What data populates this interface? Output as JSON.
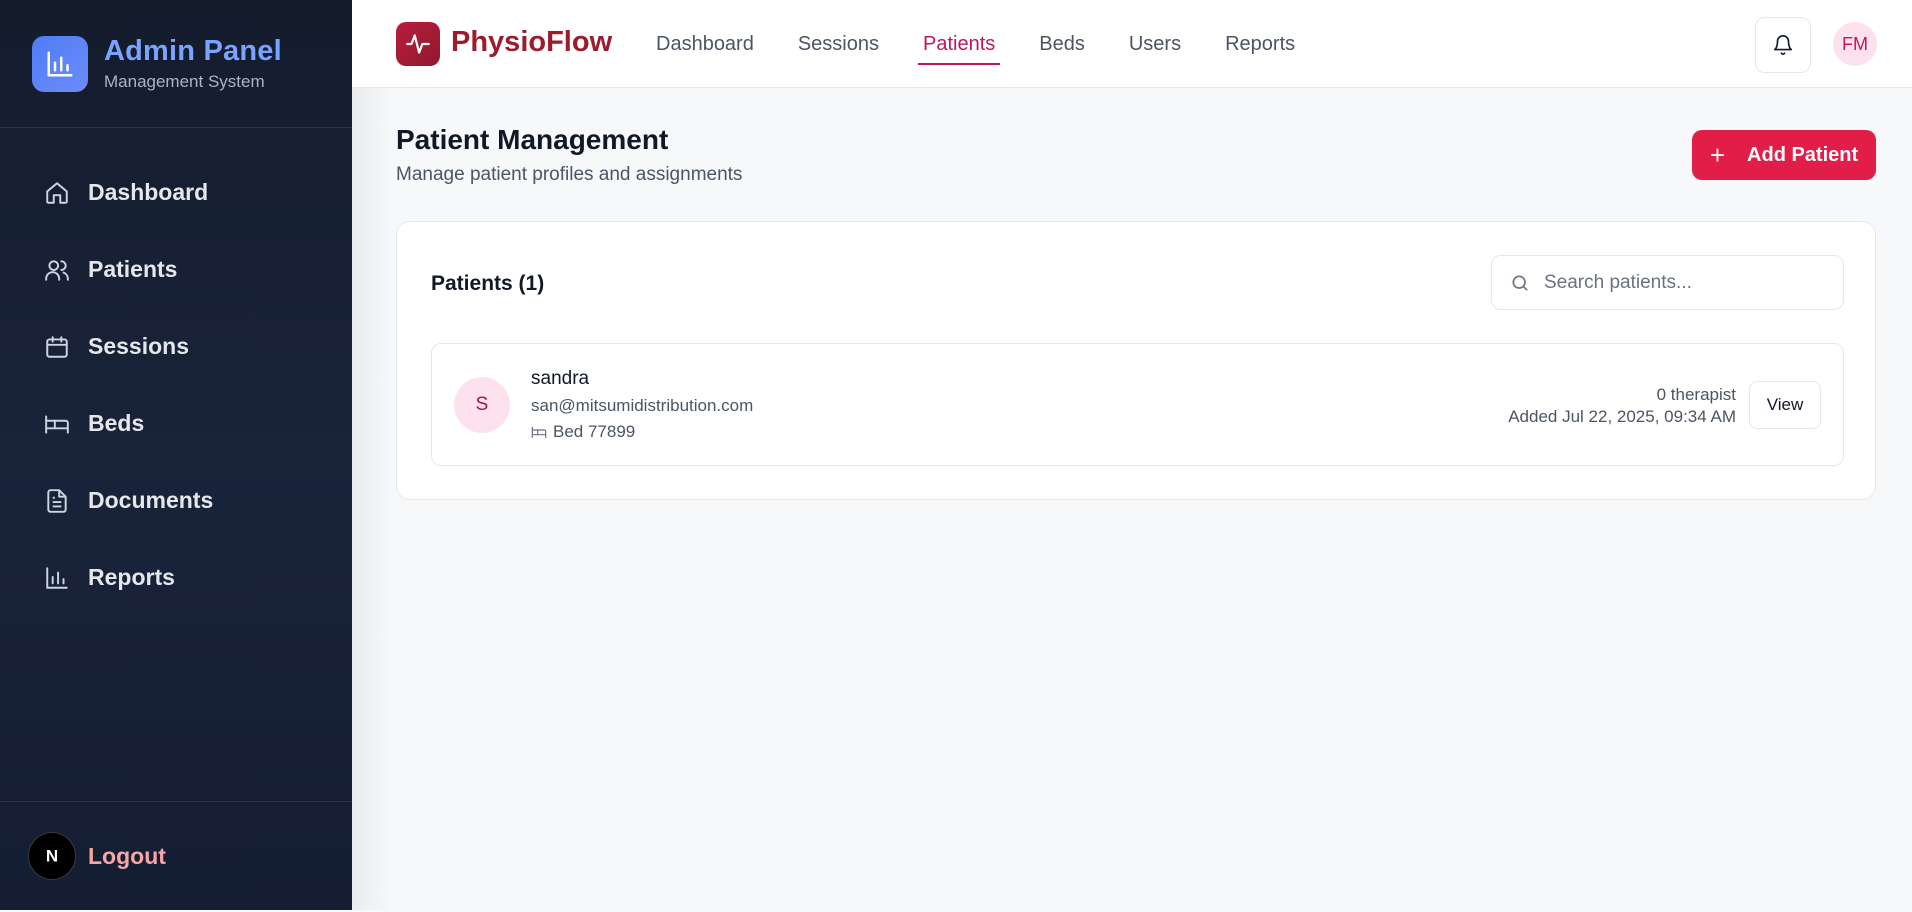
{
  "sidebar": {
    "title": "Admin Panel",
    "subtitle": "Management System",
    "logo_icon": "bar-chart-icon",
    "items": [
      {
        "label": "Dashboard",
        "icon": "home-icon"
      },
      {
        "label": "Patients",
        "icon": "users-icon"
      },
      {
        "label": "Sessions",
        "icon": "calendar-icon"
      },
      {
        "label": "Beds",
        "icon": "bed-icon"
      },
      {
        "label": "Documents",
        "icon": "document-icon"
      },
      {
        "label": "Reports",
        "icon": "bar-chart-icon"
      }
    ],
    "footer": {
      "avatar_letter": "N",
      "logout_label": "Logout"
    }
  },
  "topbar": {
    "brand": "PhysioFlow",
    "brand_icon": "activity-icon",
    "nav": [
      "Dashboard",
      "Sessions",
      "Patients",
      "Beds",
      "Users",
      "Reports"
    ],
    "active_nav": "Patients",
    "bell_icon": "bell-icon",
    "avatar_initials": "FM"
  },
  "page": {
    "title": "Patient Management",
    "subtitle": "Manage patient profiles and assignments",
    "add_button_label": "Add Patient"
  },
  "patients_card": {
    "title": "Patients (1)",
    "search_placeholder": "Search patients...",
    "patients": [
      {
        "initial": "S",
        "name": "sandra",
        "email": "san@mitsumidistribution.com",
        "bed": "Bed 77899",
        "therapists": "0 therapist",
        "added": "Added Jul 22, 2025, 09:34 AM",
        "action_label": "View"
      }
    ]
  },
  "colors": {
    "sidebar_bg": "#141c2c",
    "sidebar_title": "#7aa2ff",
    "accent": "#e11d48",
    "brand": "#9b1c2c",
    "active_tab": "#be185d",
    "logout": "#f8a5a8"
  }
}
